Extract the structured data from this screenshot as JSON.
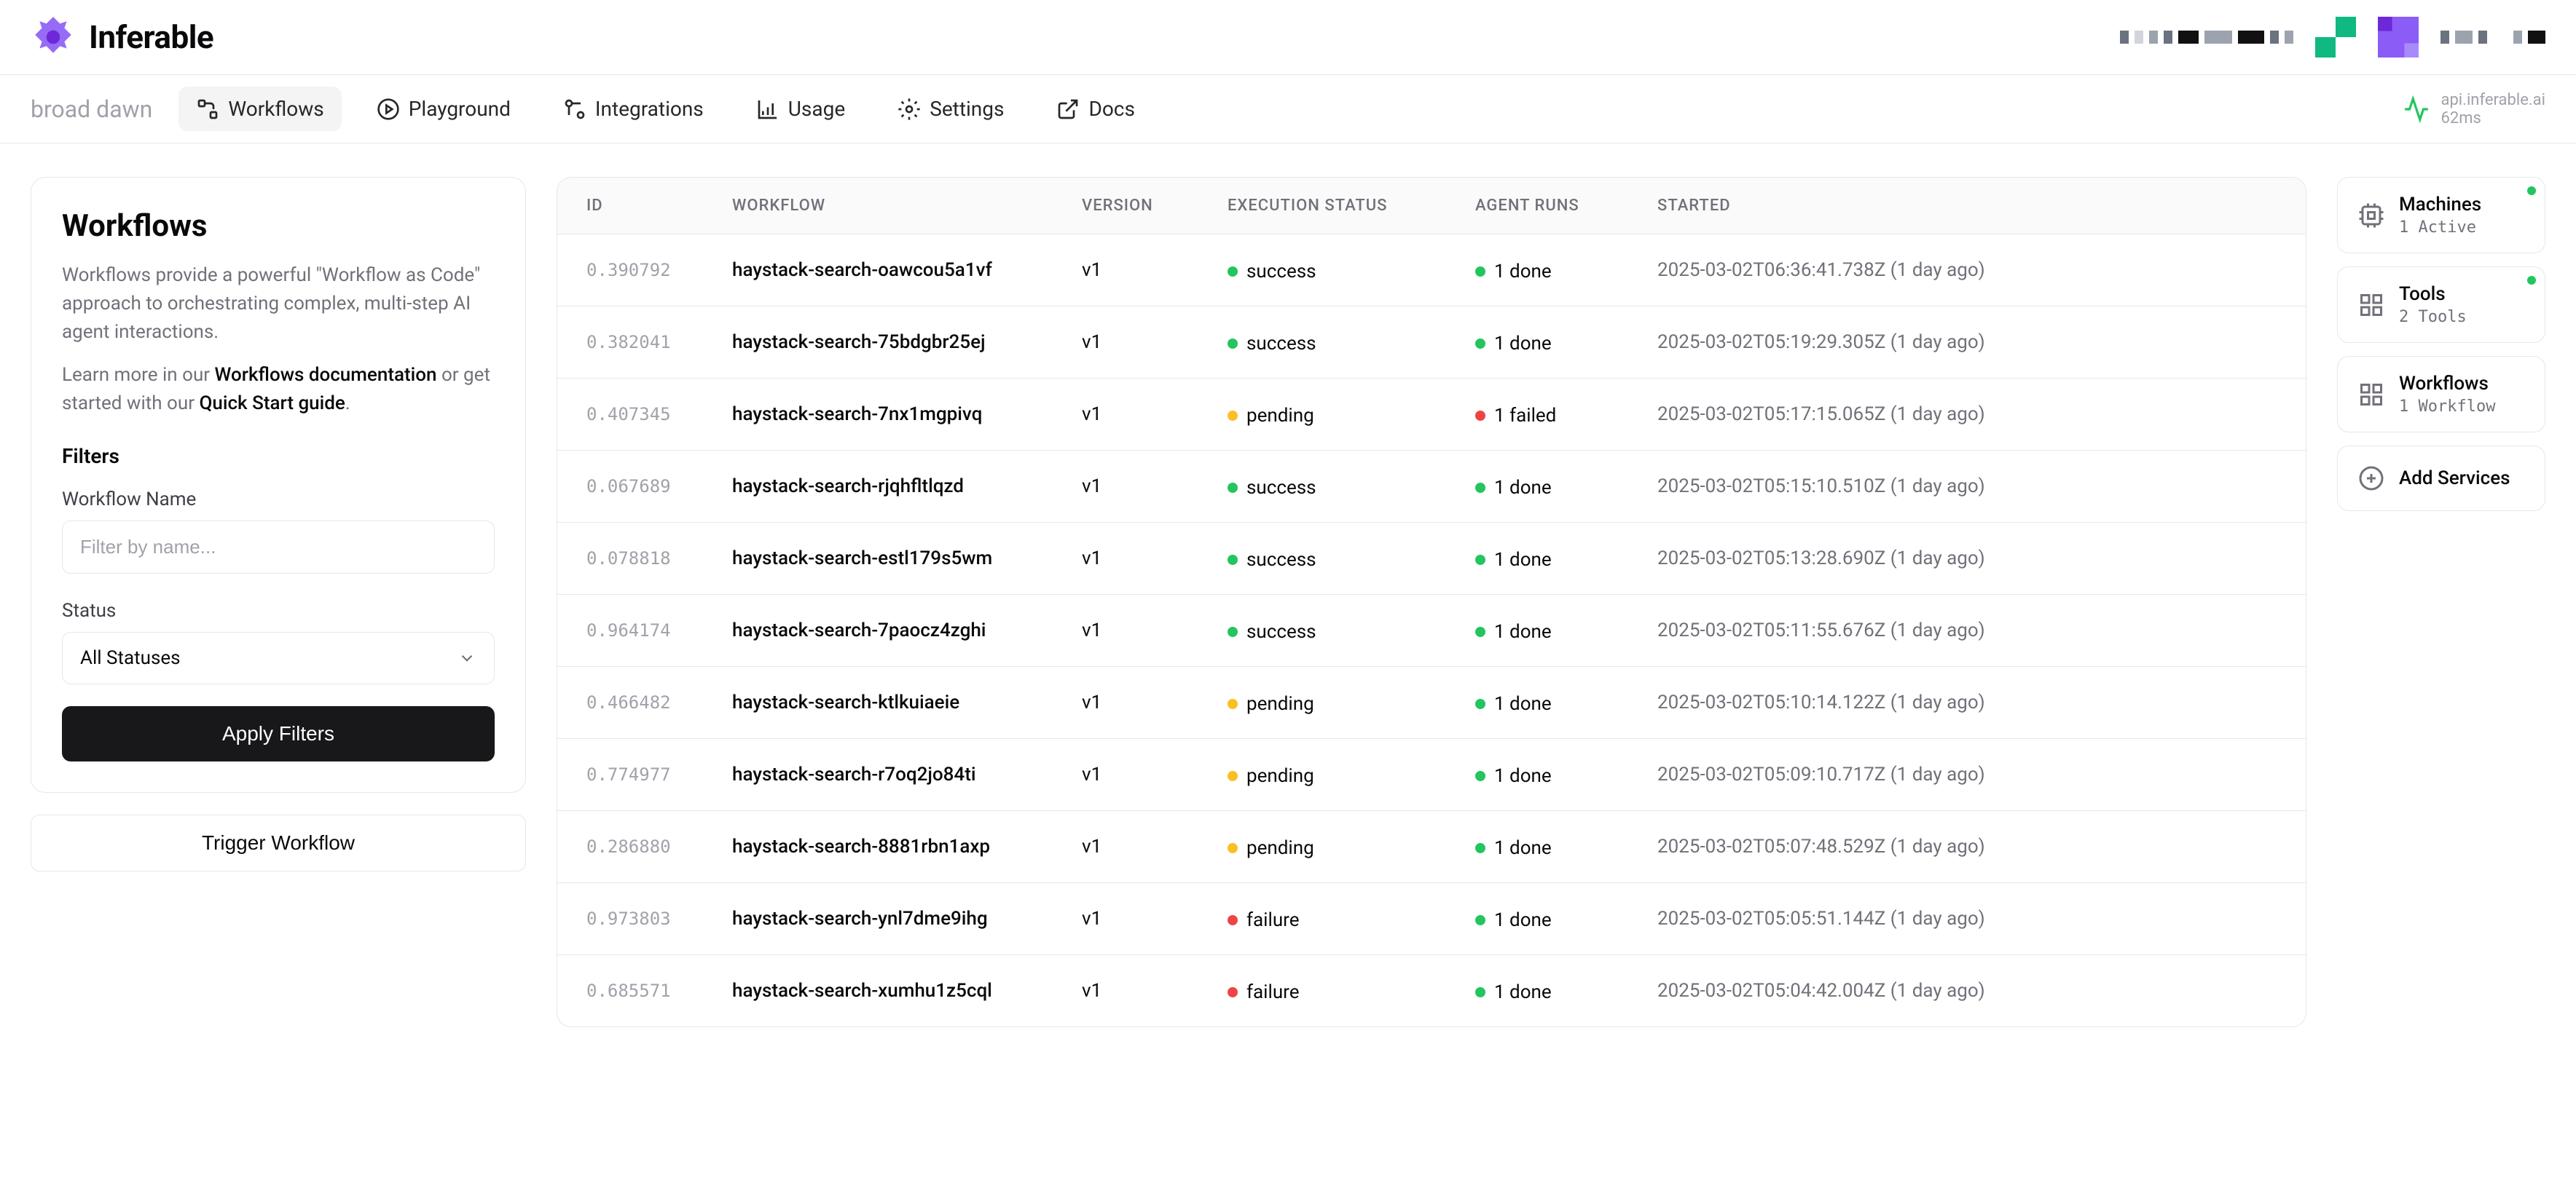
{
  "brand": {
    "name": "Inferable"
  },
  "cluster": "broad dawn",
  "nav": {
    "workflows": "Workflows",
    "playground": "Playground",
    "integrations": "Integrations",
    "usage": "Usage",
    "settings": "Settings",
    "docs": "Docs"
  },
  "api": {
    "host": "api.inferable.ai",
    "latency": "62ms"
  },
  "panel": {
    "title": "Workflows",
    "desc_1": "Workflows provide a powerful \"Workflow as Code\" approach to orchestrating complex, multi-step AI agent interactions.",
    "desc_2a": "Learn more in our ",
    "desc_2_link1": "Workflows documentation",
    "desc_2b": " or get started with our ",
    "desc_2_link2": "Quick Start guide",
    "desc_2c": ".",
    "filters_label": "Filters",
    "name_label": "Workflow Name",
    "name_placeholder": "Filter by name...",
    "status_label": "Status",
    "status_value": "All Statuses",
    "apply": "Apply Filters",
    "trigger": "Trigger Workflow"
  },
  "table": {
    "headers": {
      "id": "ID",
      "workflow": "WORKFLOW",
      "version": "VERSION",
      "exec": "EXECUTION STATUS",
      "runs": "AGENT RUNS",
      "started": "STARTED"
    },
    "rows": [
      {
        "id": "0.390792",
        "workflow": "haystack-search-oawcou5a1vf",
        "version": "v1",
        "exec": "success",
        "exec_color": "success",
        "runs": "1 done",
        "runs_color": "success",
        "started": "2025-03-02T06:36:41.738Z (1 day ago)"
      },
      {
        "id": "0.382041",
        "workflow": "haystack-search-75bdgbr25ej",
        "version": "v1",
        "exec": "success",
        "exec_color": "success",
        "runs": "1 done",
        "runs_color": "success",
        "started": "2025-03-02T05:19:29.305Z (1 day ago)"
      },
      {
        "id": "0.407345",
        "workflow": "haystack-search-7nx1mgpivq",
        "version": "v1",
        "exec": "pending",
        "exec_color": "pending",
        "runs": "1 failed",
        "runs_color": "failure",
        "started": "2025-03-02T05:17:15.065Z (1 day ago)"
      },
      {
        "id": "0.067689",
        "workflow": "haystack-search-rjqhfltlqzd",
        "version": "v1",
        "exec": "success",
        "exec_color": "success",
        "runs": "1 done",
        "runs_color": "success",
        "started": "2025-03-02T05:15:10.510Z (1 day ago)"
      },
      {
        "id": "0.078818",
        "workflow": "haystack-search-estl179s5wm",
        "version": "v1",
        "exec": "success",
        "exec_color": "success",
        "runs": "1 done",
        "runs_color": "success",
        "started": "2025-03-02T05:13:28.690Z (1 day ago)"
      },
      {
        "id": "0.964174",
        "workflow": "haystack-search-7paocz4zghi",
        "version": "v1",
        "exec": "success",
        "exec_color": "success",
        "runs": "1 done",
        "runs_color": "success",
        "started": "2025-03-02T05:11:55.676Z (1 day ago)"
      },
      {
        "id": "0.466482",
        "workflow": "haystack-search-ktlkuiaeie",
        "version": "v1",
        "exec": "pending",
        "exec_color": "pending",
        "runs": "1 done",
        "runs_color": "success",
        "started": "2025-03-02T05:10:14.122Z (1 day ago)"
      },
      {
        "id": "0.774977",
        "workflow": "haystack-search-r7oq2jo84ti",
        "version": "v1",
        "exec": "pending",
        "exec_color": "pending",
        "runs": "1 done",
        "runs_color": "success",
        "started": "2025-03-02T05:09:10.717Z (1 day ago)"
      },
      {
        "id": "0.286880",
        "workflow": "haystack-search-8881rbn1axp",
        "version": "v1",
        "exec": "pending",
        "exec_color": "pending",
        "runs": "1 done",
        "runs_color": "success",
        "started": "2025-03-02T05:07:48.529Z (1 day ago)"
      },
      {
        "id": "0.973803",
        "workflow": "haystack-search-ynl7dme9ihg",
        "version": "v1",
        "exec": "failure",
        "exec_color": "failure",
        "runs": "1 done",
        "runs_color": "success",
        "started": "2025-03-02T05:05:51.144Z (1 day ago)"
      },
      {
        "id": "0.685571",
        "workflow": "haystack-search-xumhu1z5cql",
        "version": "v1",
        "exec": "failure",
        "exec_color": "failure",
        "runs": "1 done",
        "runs_color": "success",
        "started": "2025-03-02T05:04:42.004Z (1 day ago)"
      }
    ]
  },
  "services": {
    "machines": {
      "name": "Machines",
      "meta": "1 Active"
    },
    "tools": {
      "name": "Tools",
      "meta": "2 Tools"
    },
    "workflows": {
      "name": "Workflows",
      "meta": "1 Workflow"
    },
    "add": "Add Services"
  }
}
